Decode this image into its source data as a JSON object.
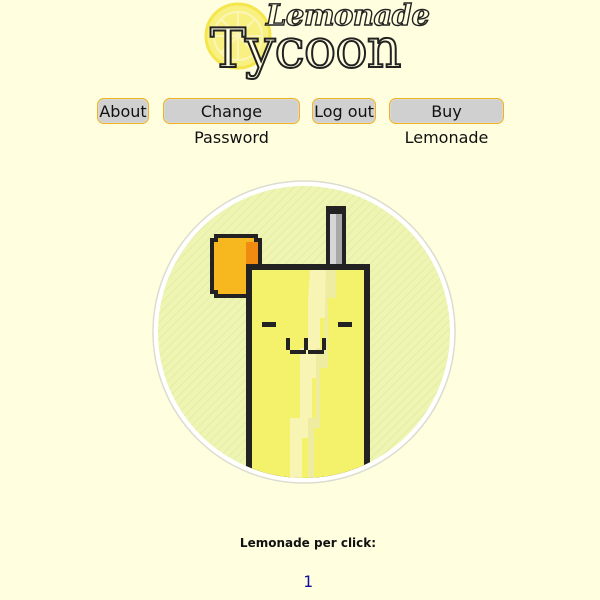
{
  "logo": {
    "top_word": "Lemonade",
    "main_word": "Tycoon"
  },
  "nav": {
    "about": "About",
    "change_password": "Change Password",
    "log_out": "Log out",
    "buy_lemonade": "Buy Lemonade"
  },
  "stats": {
    "per_click_label": "Lemonade per click:",
    "per_click_value": "1"
  },
  "colors": {
    "background": "#fffedf",
    "button_bg": "#cfd0cf",
    "button_border": "#f0b21e",
    "circle_fill": "#eef4b2",
    "glass_yellow": "#f4f16a",
    "orange": "#f7b81f",
    "value_text": "#1010a0"
  },
  "icons": {
    "logo_lemon": "lemon-slice-icon",
    "clicker": "lemonade-glass-icon"
  }
}
